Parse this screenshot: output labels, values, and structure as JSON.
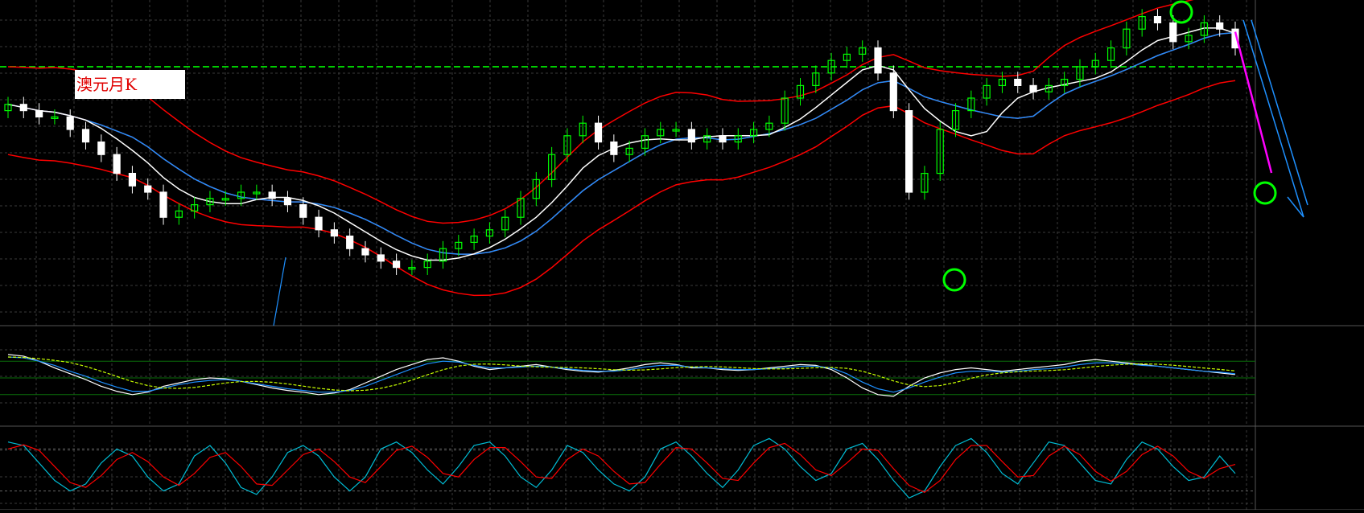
{
  "chart_title_label": "澳元月K",
  "colors": {
    "background": "#000000",
    "grid": "#3a3a3a",
    "bull_candle": "#00ff00",
    "bear_candle": "#ffffff",
    "bollinger": "#ff0000",
    "ma_fast": "#ffffff",
    "ma_slow": "#1e90ff",
    "horizontal_level": "#00cc00",
    "forecast_magenta": "#ff00ff",
    "forecast_blue": "#1e90ff",
    "circle_marker": "#00ff00",
    "stoch_main": "#00bcd4",
    "stoch_signal": "#ff0000"
  },
  "chart_data": [
    {
      "type": "candlestick",
      "panel": "price",
      "title": "澳元月K",
      "ylim": [
        0.6,
        1.1
      ],
      "grid": true,
      "horizontal_level": 1.0,
      "series_close": [
        0.94,
        0.93,
        0.92,
        0.92,
        0.9,
        0.88,
        0.86,
        0.83,
        0.81,
        0.8,
        0.76,
        0.77,
        0.78,
        0.79,
        0.79,
        0.8,
        0.8,
        0.79,
        0.78,
        0.76,
        0.74,
        0.73,
        0.71,
        0.7,
        0.69,
        0.68,
        0.68,
        0.69,
        0.71,
        0.72,
        0.73,
        0.74,
        0.76,
        0.79,
        0.82,
        0.86,
        0.89,
        0.91,
        0.88,
        0.86,
        0.87,
        0.89,
        0.9,
        0.9,
        0.88,
        0.89,
        0.88,
        0.89,
        0.9,
        0.91,
        0.95,
        0.97,
        0.99,
        1.01,
        1.02,
        1.03,
        0.99,
        0.93,
        0.8,
        0.83,
        0.9,
        0.93,
        0.95,
        0.97,
        0.98,
        0.97,
        0.96,
        0.97,
        0.98,
        1.0,
        1.01,
        1.03,
        1.06,
        1.08,
        1.07,
        1.04,
        1.05,
        1.07,
        1.06,
        1.03
      ]
    },
    {
      "type": "line",
      "panel": "oscillator",
      "ylim": [
        0,
        100
      ],
      "levels": [
        70,
        50,
        30
      ],
      "series": [
        {
          "values": [
            78,
            76,
            70,
            62,
            55,
            48,
            40,
            34,
            30,
            33,
            40,
            44,
            48,
            50,
            49,
            46,
            42,
            38,
            35,
            33,
            30,
            32,
            36,
            44,
            52,
            60,
            66,
            72,
            74,
            70,
            64,
            60,
            62,
            64,
            66,
            63,
            60,
            58,
            57,
            59,
            62,
            66,
            68,
            66,
            62,
            62,
            60,
            59,
            60,
            62,
            64,
            66,
            65,
            60,
            50,
            38,
            30,
            28,
            40,
            50,
            56,
            60,
            62,
            60,
            58,
            60,
            62,
            64,
            66,
            70,
            72,
            70,
            68,
            66,
            64,
            62,
            60,
            58,
            56,
            54
          ]
        },
        {
          "values": [
            75,
            74,
            70,
            65,
            58,
            52,
            45,
            39,
            34,
            34,
            38,
            42,
            45,
            47,
            48,
            46,
            43,
            40,
            37,
            35,
            33,
            33,
            35,
            40,
            47,
            54,
            61,
            67,
            70,
            69,
            65,
            62,
            62,
            63,
            64,
            63,
            61,
            59,
            58,
            58,
            60,
            63,
            65,
            65,
            63,
            62,
            61,
            60,
            60,
            61,
            62,
            64,
            64,
            62,
            55,
            45,
            37,
            33,
            38,
            45,
            51,
            56,
            58,
            58,
            57,
            58,
            60,
            61,
            63,
            66,
            68,
            68,
            67,
            65,
            64,
            62,
            60,
            58,
            57,
            55
          ]
        }
      ]
    },
    {
      "type": "line",
      "panel": "stochastic",
      "ylim": [
        0,
        100
      ],
      "levels": [
        80,
        20
      ],
      "series": [
        {
          "values": [
            90,
            85,
            60,
            35,
            20,
            30,
            60,
            80,
            70,
            40,
            20,
            30,
            70,
            85,
            60,
            25,
            15,
            40,
            75,
            85,
            70,
            40,
            20,
            40,
            80,
            90,
            75,
            50,
            30,
            55,
            85,
            90,
            70,
            40,
            25,
            50,
            85,
            75,
            50,
            30,
            20,
            40,
            80,
            90,
            70,
            45,
            25,
            50,
            85,
            95,
            80,
            55,
            35,
            45,
            80,
            88,
            65,
            35,
            10,
            20,
            55,
            85,
            95,
            75,
            45,
            30,
            60,
            90,
            85,
            60,
            35,
            30,
            65,
            90,
            80,
            55,
            35,
            40,
            70,
            45
          ]
        },
        {
          "values": [
            80,
            86,
            78,
            55,
            32,
            25,
            42,
            65,
            75,
            62,
            40,
            28,
            45,
            68,
            75,
            55,
            30,
            28,
            50,
            72,
            80,
            62,
            40,
            32,
            55,
            78,
            84,
            68,
            45,
            40,
            65,
            82,
            82,
            62,
            40,
            38,
            65,
            80,
            70,
            48,
            30,
            32,
            58,
            82,
            80,
            60,
            38,
            35,
            60,
            82,
            88,
            72,
            50,
            42,
            60,
            80,
            78,
            52,
            28,
            18,
            35,
            65,
            85,
            85,
            62,
            40,
            42,
            70,
            84,
            72,
            48,
            34,
            48,
            72,
            84,
            70,
            48,
            38,
            52,
            58
          ]
        }
      ]
    }
  ]
}
